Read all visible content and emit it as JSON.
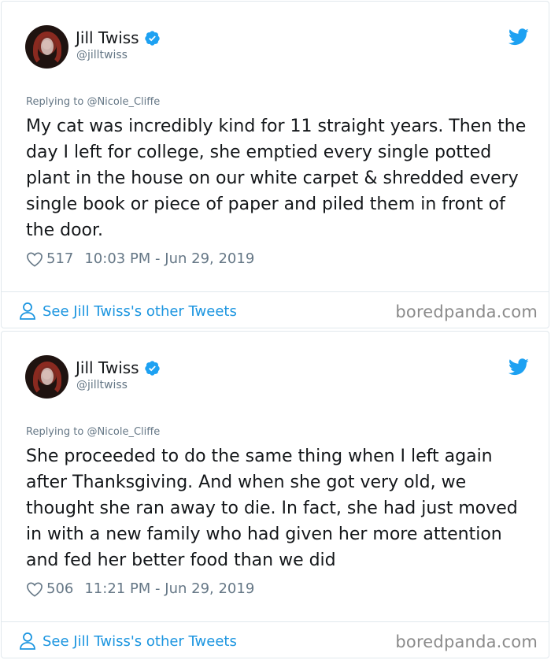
{
  "tweets": [
    {
      "author_name": "Jill Twiss",
      "handle": "@jilltwiss",
      "replying_prefix": "Replying to",
      "replying_to": "@Nicole_Cliffe",
      "text": "My cat was incredibly kind for 11 straight years. Then the day I left for college, she emptied every single potted plant in the house on our white carpet & shredded every single book or piece of paper and piled them in front of the door.",
      "likes": "517",
      "timestamp": "10:03 PM - Jun 29, 2019",
      "see_more": "See Jill Twiss's other Tweets",
      "watermark": "boredpanda.com"
    },
    {
      "author_name": "Jill Twiss",
      "handle": "@jilltwiss",
      "replying_prefix": "Replying to",
      "replying_to": "@Nicole_Cliffe",
      "text": "She proceeded to do the same thing when I left again after Thanksgiving. And when she got very old, we thought she ran away to die. In fact, she had just moved in with a new family who had given her more attention and fed her better food than we did",
      "likes": "506",
      "timestamp": "11:21 PM - Jun 29, 2019",
      "see_more": "See Jill Twiss's other Tweets",
      "watermark": "boredpanda.com"
    }
  ],
  "colors": {
    "twitter_blue": "#1da1f2",
    "link_blue": "#1b95e0",
    "muted_gray": "#657786",
    "border": "#e1e8ed"
  },
  "icons": [
    "verified-badge-icon",
    "twitter-bird-icon",
    "heart-icon",
    "person-icon"
  ]
}
